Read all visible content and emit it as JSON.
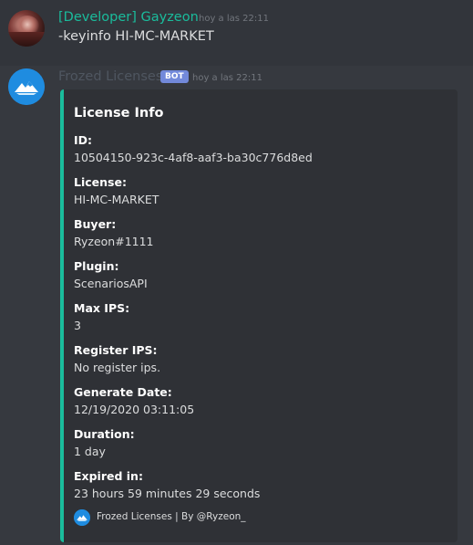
{
  "messages": {
    "user": {
      "username": "[Developer] Gayzeon",
      "timestamp": "hoy a las 22:11",
      "content": "-keyinfo HI-MC-MARKET"
    },
    "bot": {
      "username": "Frozed Licenses",
      "tag": "BOT",
      "timestamp": "hoy a las 22:11"
    }
  },
  "embed": {
    "title": "License Info",
    "fields": [
      {
        "name": "ID:",
        "value": "10504150-923c-4af8-aaf3-ba30c776d8ed"
      },
      {
        "name": "License:",
        "value": "HI-MC-MARKET"
      },
      {
        "name": "Buyer:",
        "value": "Ryzeon#1111"
      },
      {
        "name": "Plugin:",
        "value": "ScenariosAPI"
      },
      {
        "name": "Max IPS:",
        "value": "3"
      },
      {
        "name": "Register IPS:",
        "value": "No register ips."
      },
      {
        "name": "Generate Date:",
        "value": "12/19/2020 03:11:05"
      },
      {
        "name": "Duration:",
        "value": "1 day"
      },
      {
        "name": "Expired in:",
        "value": "23 hours 59 minutes 29 seconds"
      }
    ],
    "footer": "Frozed Licenses | By @Ryzeon_"
  },
  "colors": {
    "background": "#36393f",
    "embed_background": "#2f3136",
    "embed_accent": "#1abc9c",
    "user_name": "#1abc9c",
    "bot_tag": "#7289da",
    "bot_avatar": "#1f8ce0"
  },
  "icons": {
    "user_avatar": "user-avatar",
    "bot_avatar": "mountain-logo-icon",
    "footer_icon": "mountain-logo-icon"
  }
}
